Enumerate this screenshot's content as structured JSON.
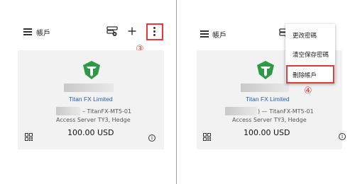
{
  "left": {
    "screen_title": "帳戶",
    "step_marker": "③",
    "card": {
      "broker": "Titan FX Limited",
      "server_suffix": "– TitanFX-MT5-01",
      "server_line": "Access Server TY3, Hedge",
      "balance": "100.00 USD"
    }
  },
  "right": {
    "screen_title": "帳戶",
    "step_marker": "④",
    "dropdown": {
      "items": [
        "更改密碼",
        "清空保存密碼",
        "刪除帳戶"
      ]
    },
    "card": {
      "broker": "Titan FX Limited",
      "server_suffix": ") — TitanFX-MT5-01",
      "server_line": "Access Server TY3, Hedge",
      "balance": "100.00 USD"
    }
  },
  "colors": {
    "highlight": "#e53935",
    "brand_green": "#2e9a47",
    "broker_link": "#1e5fbf"
  },
  "icons": [
    "menu-icon",
    "server-settings-icon",
    "plus-icon",
    "more-vert-icon",
    "titan-logo",
    "qr-code-icon",
    "info-icon"
  ]
}
